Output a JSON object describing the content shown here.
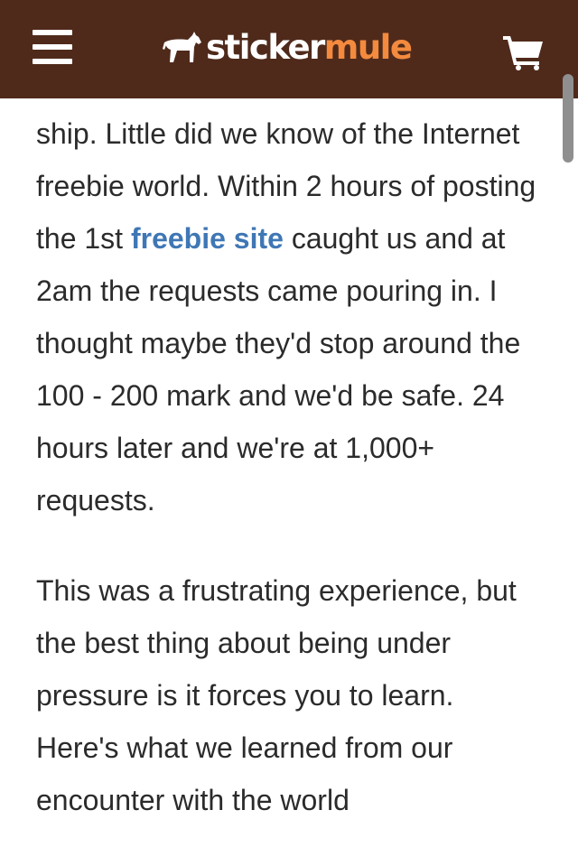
{
  "navbar": {
    "logo_part1": "sticker",
    "logo_part2": "mule",
    "menu_icon": "hamburger-menu-icon",
    "cart_icon": "shopping-cart-icon",
    "background_color": "#4f2a1b",
    "brand_accent_color": "#f38a3e"
  },
  "article": {
    "paragraph1": {
      "text_before_link": "ship. Little did we know of the Internet freebie world. Within 2 hours of posting the 1st ",
      "link_text": "freebie site",
      "text_after_link": " caught us and at 2am the requests came pouring in. I thought maybe they'd stop around the 100 - 200 mark and we'd be safe. 24 hours later and we're at 1,000+ requests."
    },
    "paragraph2": "This was a frustrating experience, but the best thing about being under pressure is it forces you to learn. Here's what we learned from our encounter with the world",
    "link_color": "#3f77b5"
  }
}
